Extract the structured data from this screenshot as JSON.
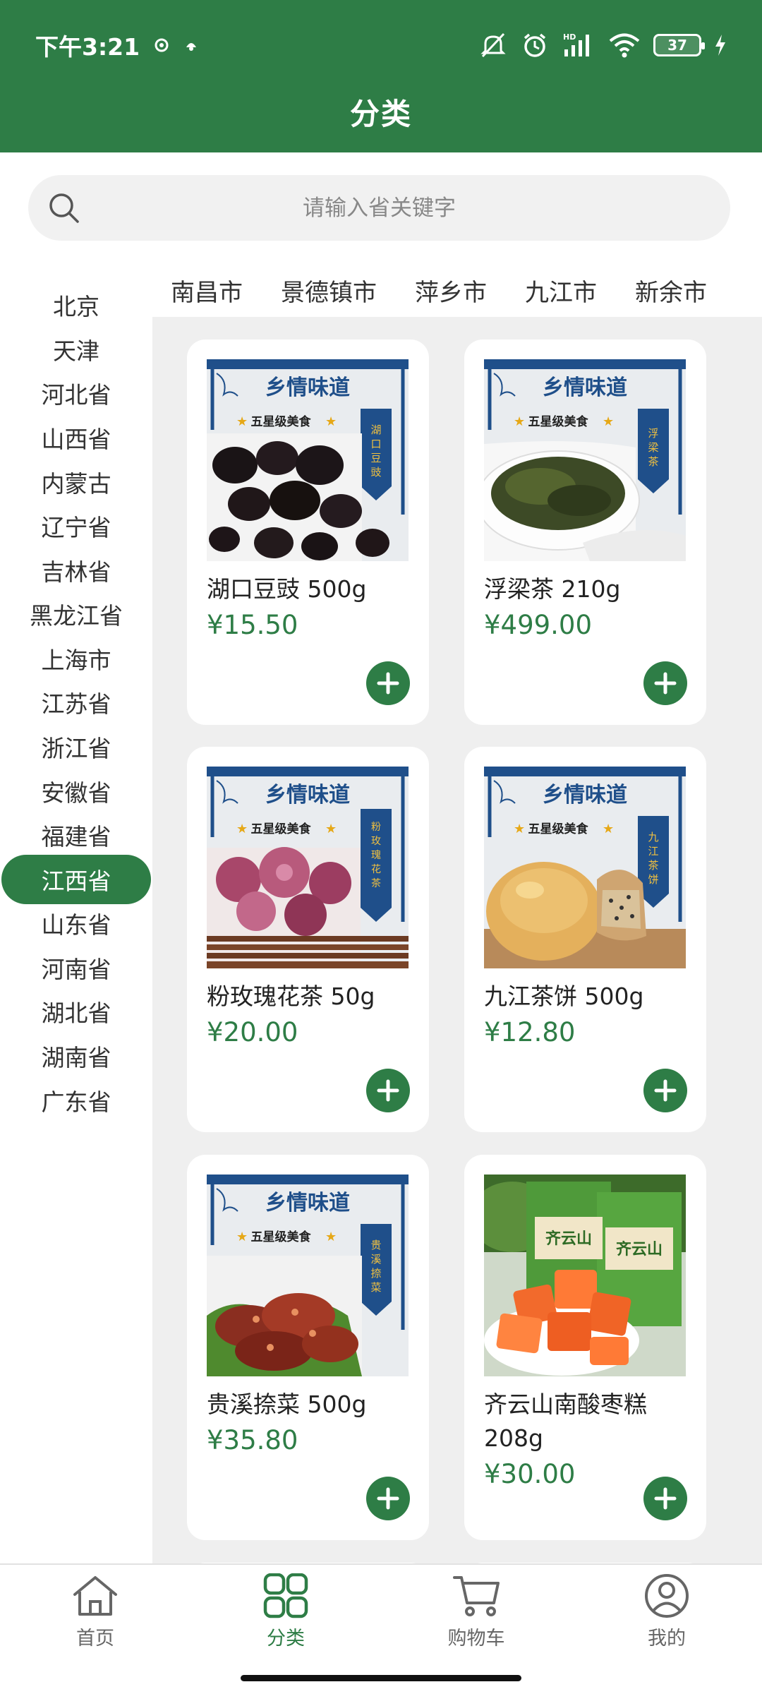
{
  "status_bar": {
    "time": "下午3:21",
    "battery": "37"
  },
  "header": {
    "title": "分类"
  },
  "search": {
    "placeholder": "请输入省关键字"
  },
  "sidebar": {
    "items": [
      "北京",
      "天津",
      "河北省",
      "山西省",
      "内蒙古",
      "辽宁省",
      "吉林省",
      "黑龙江省",
      "上海市",
      "江苏省",
      "浙江省",
      "安徽省",
      "福建省",
      "江西省",
      "山东省",
      "河南省",
      "湖北省",
      "湖南省",
      "广东省"
    ],
    "active": "江西省"
  },
  "city_tabs": [
    "南昌市",
    "景德镇市",
    "萍乡市",
    "九江市",
    "新余市"
  ],
  "products": [
    {
      "name": "湖口豆豉 500g",
      "price": "¥15.50",
      "banner": "乡情味道",
      "tag": "五星级美食",
      "side_label": "湖口豆豉"
    },
    {
      "name": "浮梁茶 210g",
      "price": "¥499.00",
      "banner": "乡情味道",
      "tag": "五星级美食",
      "side_label": "浮梁茶"
    },
    {
      "name": "粉玫瑰花茶 50g",
      "price": "¥20.00",
      "banner": "乡情味道",
      "tag": "五星级美食",
      "side_label": "粉玫瑰花茶"
    },
    {
      "name": "九江茶饼 500g",
      "price": "¥12.80",
      "banner": "乡情味道",
      "tag": "五星级美食",
      "side_label": "九江茶饼"
    },
    {
      "name": "贵溪捺菜 500g",
      "price": "¥35.80",
      "banner": "乡情味道",
      "tag": "五星级美食",
      "side_label": "贵溪捺菜"
    },
    {
      "name": "齐云山南酸枣糕 208g",
      "price": "¥30.00",
      "pkg_brand": "齐云山"
    }
  ],
  "bottom_nav": [
    {
      "label": "首页",
      "icon": "home-icon"
    },
    {
      "label": "分类",
      "icon": "grid-icon"
    },
    {
      "label": "购物车",
      "icon": "cart-icon"
    },
    {
      "label": "我的",
      "icon": "user-icon"
    }
  ],
  "colors": {
    "brand": "#2e7d46",
    "banner_blue": "#1f4f8a",
    "background": "#efefef"
  }
}
